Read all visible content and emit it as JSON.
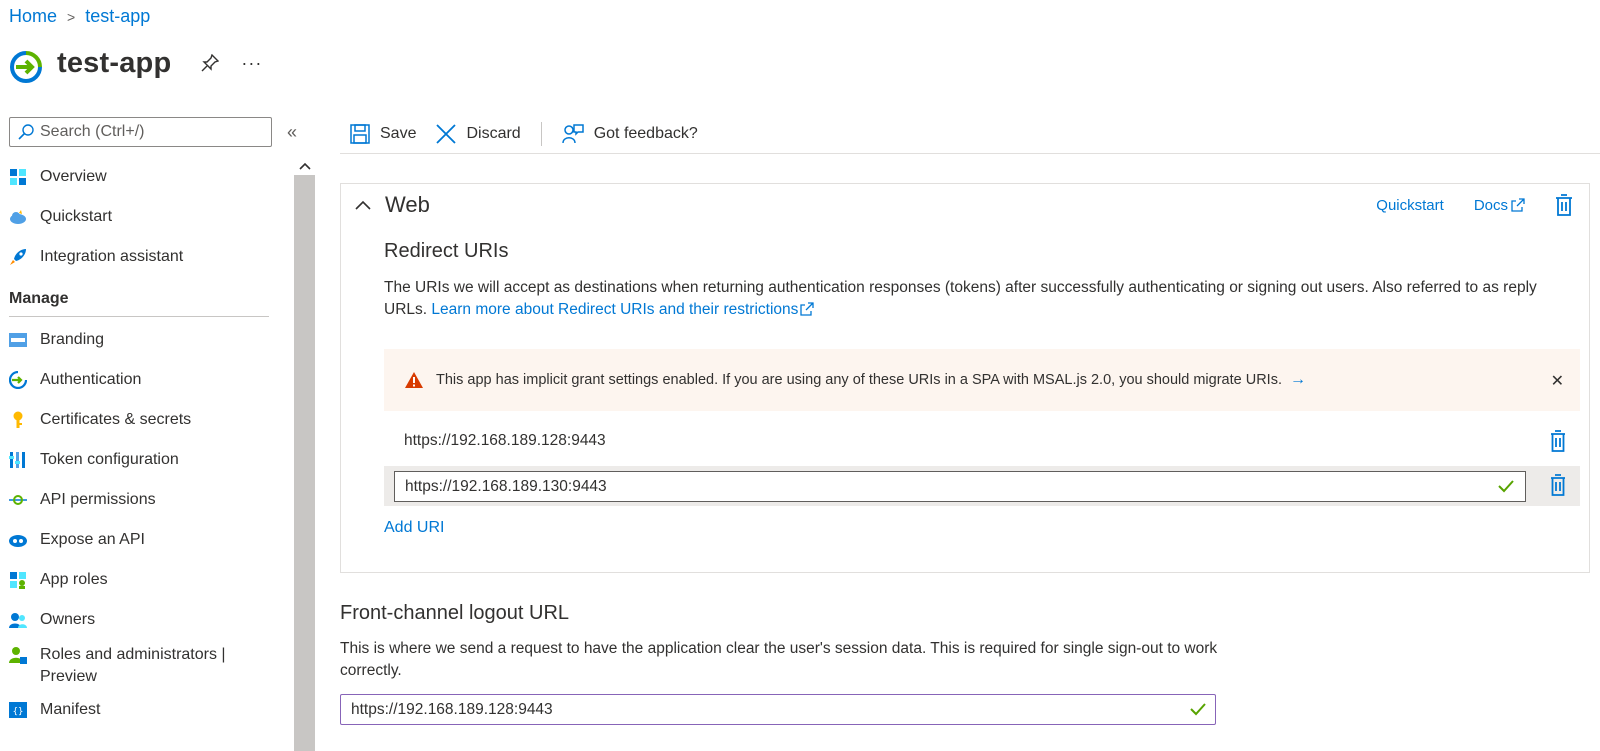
{
  "breadcrumb": {
    "home": "Home",
    "current": "test-app"
  },
  "header": {
    "title": "test-app",
    "more": "···"
  },
  "sidebar": {
    "search_placeholder": "Search (Ctrl+/)",
    "items_top": [
      {
        "label": "Overview",
        "icon": "overview-icon"
      },
      {
        "label": "Quickstart",
        "icon": "quickstart-icon"
      },
      {
        "label": "Integration assistant",
        "icon": "rocket-icon"
      }
    ],
    "manage_label": "Manage",
    "items_manage": [
      {
        "label": "Branding",
        "icon": "branding-icon"
      },
      {
        "label": "Authentication",
        "icon": "authentication-icon"
      },
      {
        "label": "Certificates & secrets",
        "icon": "key-icon"
      },
      {
        "label": "Token configuration",
        "icon": "token-icon"
      },
      {
        "label": "API permissions",
        "icon": "api-permissions-icon"
      },
      {
        "label": "Expose an API",
        "icon": "expose-api-icon"
      },
      {
        "label": "App roles",
        "icon": "app-roles-icon"
      },
      {
        "label": "Owners",
        "icon": "owners-icon"
      },
      {
        "label": "Roles and administrators |",
        "label2": "Preview",
        "icon": "roles-icon"
      },
      {
        "label": "Manifest",
        "icon": "manifest-icon"
      }
    ]
  },
  "toolbar": {
    "save": "Save",
    "discard": "Discard",
    "feedback": "Got feedback?"
  },
  "web": {
    "title": "Web",
    "quickstart": "Quickstart",
    "docs": "Docs",
    "redirect_title": "Redirect URIs",
    "redirect_desc": "The URIs we will accept as destinations when returning authentication responses (tokens) after successfully authenticating or signing out users. Also referred to as reply URLs.",
    "learn_more": "Learn more about Redirect URIs and their restrictions",
    "warning": "This app has implicit grant settings enabled. If you are using any of these URIs in a SPA with MSAL.js 2.0, you should migrate URIs.",
    "uris": [
      "https://192.168.189.128:9443",
      "https://192.168.189.130:9443"
    ],
    "add_uri": "Add URI"
  },
  "front_channel": {
    "title": "Front-channel logout URL",
    "desc": "This is where we send a request to have the application clear the user's session data. This is required for single sign-out to work correctly.",
    "value": "https://192.168.189.128:9443"
  },
  "colors": {
    "accent": "#0078d4",
    "warning_bg": "#fdf5ef",
    "success": "#57a300",
    "focus_border": "#8764b8"
  }
}
